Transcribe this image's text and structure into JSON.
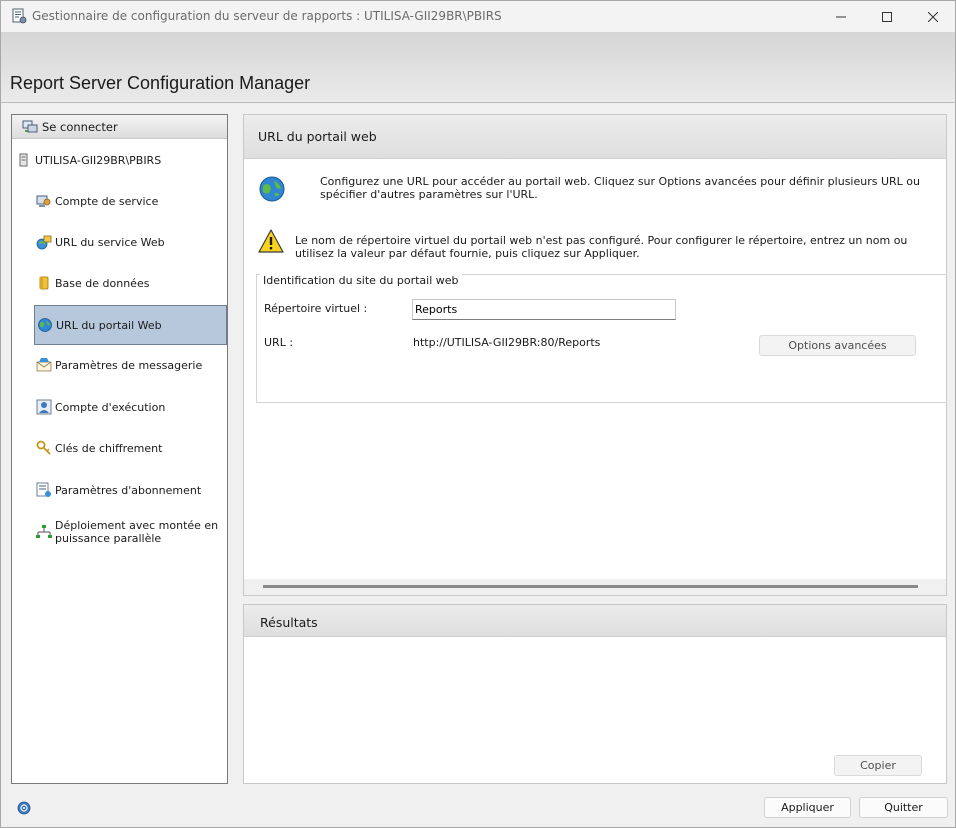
{
  "window": {
    "title": "Gestionnaire de configuration du serveur de rapports : UTILISA-GII29BR\\PBIRS"
  },
  "header": {
    "app_title": "Report Server Configuration Manager"
  },
  "sidebar": {
    "connect_label": "Se connecter",
    "server_label": "UTILISA-GII29BR\\PBIRS",
    "items": [
      {
        "label": "Compte de service",
        "icon": "service-account-icon"
      },
      {
        "label": "URL du service Web",
        "icon": "web-service-url-icon"
      },
      {
        "label": "Base de données",
        "icon": "database-icon"
      },
      {
        "label": "URL du portail Web",
        "icon": "globe-icon",
        "selected": true
      },
      {
        "label": "Paramètres de messagerie",
        "icon": "email-settings-icon"
      },
      {
        "label": "Compte d'exécution",
        "icon": "execution-account-icon"
      },
      {
        "label": "Clés de chiffrement",
        "icon": "keys-icon"
      },
      {
        "label": "Paramètres d'abonnement",
        "icon": "subscription-icon"
      },
      {
        "label": "Déploiement avec montée en puissance parallèle",
        "icon": "scale-out-icon"
      }
    ]
  },
  "main": {
    "title": "URL du portail web",
    "intro": "Configurez une URL pour accéder au portail web. Cliquez sur Options avancées pour définir plusieurs URL ou spécifier d'autres paramètres sur l'URL.",
    "warning": "Le nom de répertoire virtuel du portail web n'est pas configuré. Pour configurer le répertoire, entrez un nom ou utilisez la valeur par défaut fournie, puis cliquez sur Appliquer.",
    "group_label": "Identification du site du portail web",
    "vdir_label": "Répertoire virtuel :",
    "vdir_value": "Reports",
    "url_label": "URL :",
    "url_value": "http://UTILISA-GII29BR:80/Reports",
    "advanced_button": "Options avancées"
  },
  "results": {
    "title": "Résultats",
    "copy_button": "Copier"
  },
  "footer": {
    "apply_button": "Appliquer",
    "quit_button": "Quitter"
  }
}
